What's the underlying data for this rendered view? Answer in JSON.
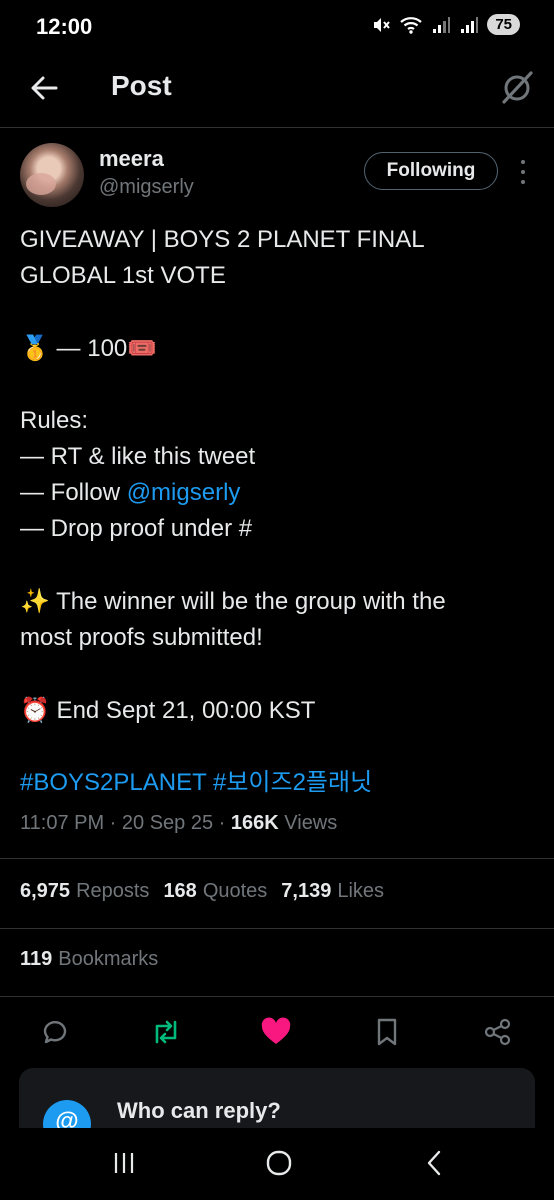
{
  "status_bar": {
    "time": "12:00",
    "battery": "75",
    "icons": [
      "mute-icon",
      "wifi-icon",
      "signal-icon",
      "signal-icon"
    ]
  },
  "header": {
    "title": "Post",
    "back_icon": "arrow-left-icon",
    "grok_icon": "grok-icon"
  },
  "author": {
    "display_name": "meera",
    "handle": "@migserly",
    "follow_label": "Following"
  },
  "tweet": {
    "line1": "GIVEAWAY | BOYS 2 PLANET FINAL",
    "line2": "GLOBAL 1st VOTE",
    "prize_emoji": "🥇",
    "prize_text": " — 100",
    "prize_ticket": "🎟️",
    "rules_title": "Rules:",
    "rule1": "— RT & like this tweet",
    "rule2_prefix": "— Follow ",
    "rule2_mention": "@migserly",
    "rule3": "— Drop proof under #",
    "winner_emoji": "✨",
    "winner_line1": " The winner will be the group with the",
    "winner_line2": "most proofs submitted!",
    "end_emoji": "⏰",
    "end_text": " End Sept 21, 00:00 KST",
    "hashtag1": "#BOYS2PLANET",
    "hashtag2": "#보이즈2플래닛"
  },
  "meta": {
    "time": "11:07 PM",
    "date": "20 Sep 25",
    "views_count": "166K",
    "views_label": "Views"
  },
  "stats": {
    "reposts_count": "6,975",
    "reposts_label": "Reposts",
    "quotes_count": "168",
    "quotes_label": "Quotes",
    "likes_count": "7,139",
    "likes_label": "Likes",
    "bookmarks_count": "119",
    "bookmarks_label": "Bookmarks"
  },
  "actions": {
    "reply_icon": "reply-icon",
    "repost_icon": "repost-icon",
    "like_icon": "heart-icon",
    "bookmark_icon": "bookmark-icon",
    "share_icon": "share-icon",
    "repost_color": "#00ba7c",
    "like_color": "#f91880"
  },
  "reply_card": {
    "title": "Who can reply?"
  },
  "colors": {
    "background": "#000000",
    "text": "#e7e9ea",
    "secondary": "#71767b",
    "link": "#1d9bf0"
  }
}
